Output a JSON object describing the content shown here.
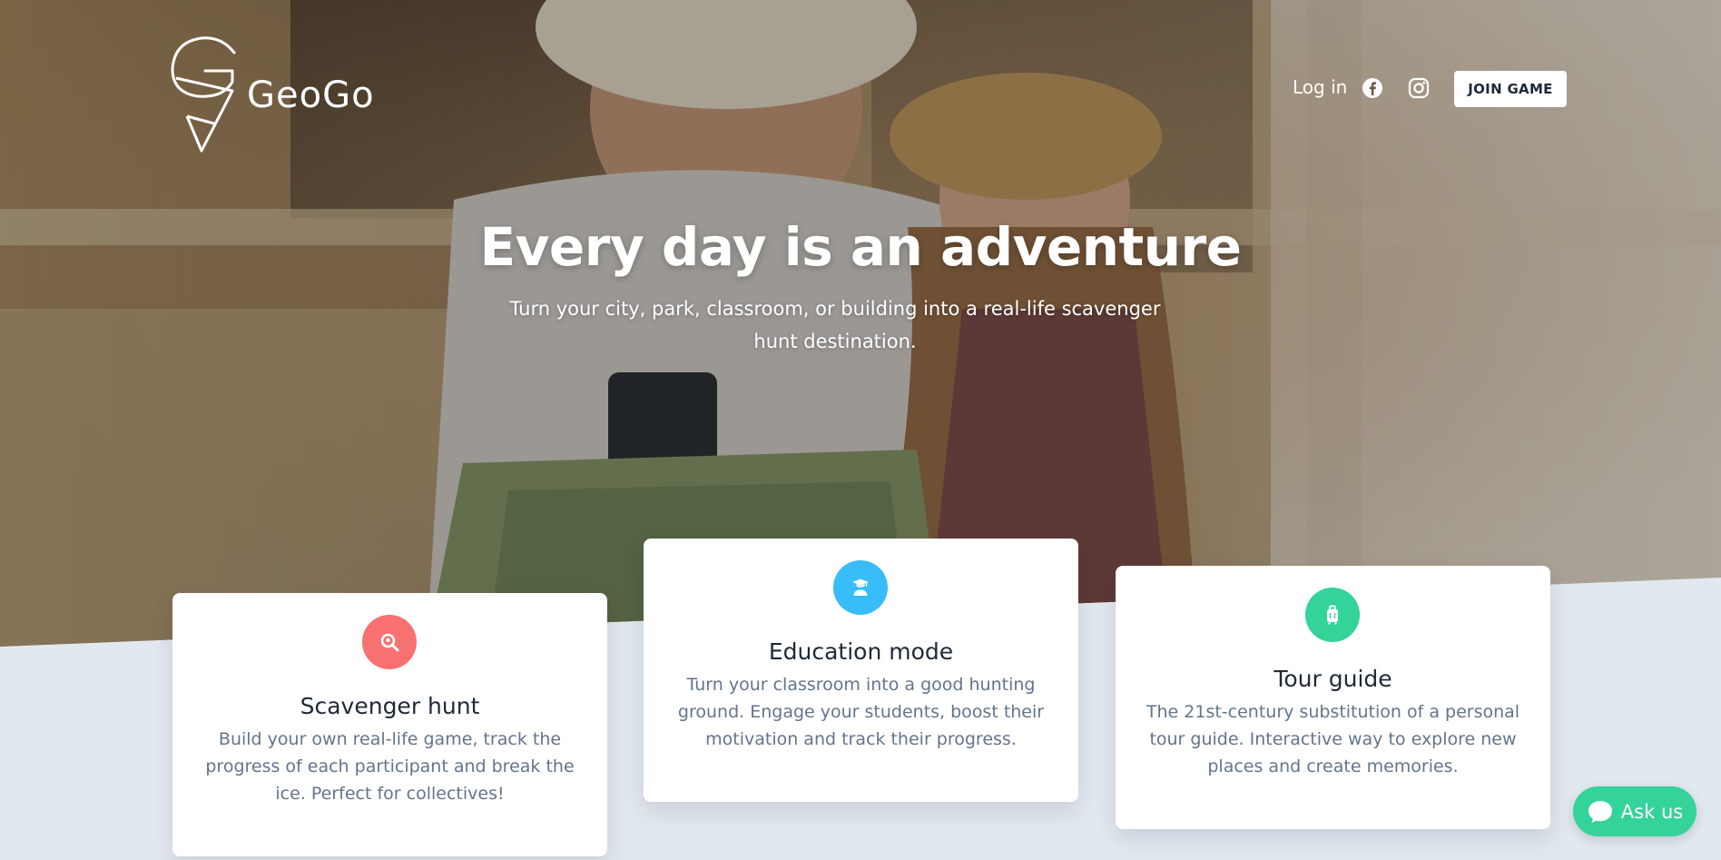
{
  "brand": {
    "name": "GeoGo"
  },
  "nav": {
    "login_label": "Log in",
    "social": [
      "facebook-icon",
      "instagram-icon"
    ],
    "join_label": "JOIN GAME"
  },
  "hero": {
    "title": "Every day is an adventure",
    "subtitle": "Turn your city, park, classroom, or building into a real-life scavenger hunt destination."
  },
  "cards": [
    {
      "icon": "search-location-icon",
      "color": "#f87171",
      "title": "Scavenger hunt",
      "text": "Build your own real-life game, track the progress of each participant and break the ice. Perfect for collectives!"
    },
    {
      "icon": "graduate-icon",
      "color": "#38bdf8",
      "title": "Education mode",
      "text": "Turn your classroom into a good hunting ground. Engage your students, boost their motivation and track their progress."
    },
    {
      "icon": "luggage-icon",
      "color": "#34d399",
      "title": "Tour guide",
      "text": "The 21st-century substitution of a personal tour guide. Interactive way to explore new places and create memories."
    }
  ],
  "chat": {
    "label": "Ask us",
    "icon": "chat-icon"
  },
  "colors": {
    "page_bg": "#e2e8f0",
    "accent_green": "#34d399"
  }
}
